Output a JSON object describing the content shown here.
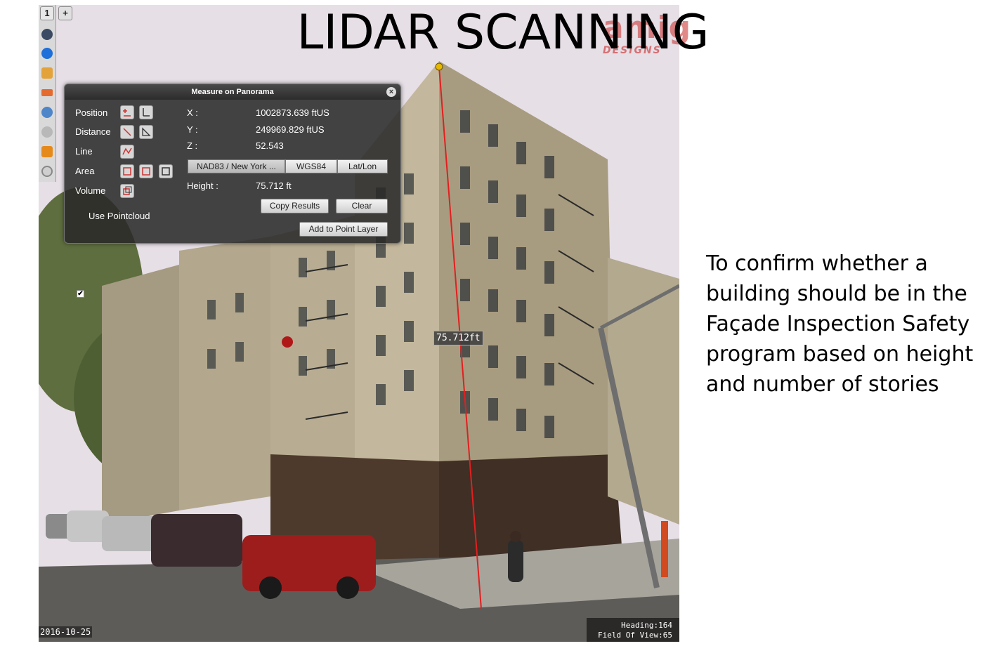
{
  "slide": {
    "title": "LIDAR SCANNING",
    "watermark": "amig",
    "watermark_sub": "DESIGNS",
    "description": "To confirm whether a building should be in the Façade Inspection Safety program based on height and number of stories"
  },
  "viewer": {
    "toolbar": {
      "zoom_level": "1",
      "zoom_in": "+",
      "tools": [
        "globe-icon",
        "info-icon",
        "layers-icon",
        "measure-icon",
        "map-icon",
        "sun-icon",
        "cluster-icon",
        "settings-icon"
      ]
    },
    "measure_panel": {
      "title": "Measure on Panorama",
      "close": "×",
      "tools": {
        "position": "Position",
        "distance": "Distance",
        "line": "Line",
        "area": "Area",
        "volume": "Volume"
      },
      "use_pointcloud": "Use Pointcloud",
      "use_pointcloud_checked": "✔",
      "coords": {
        "x_label": "X :",
        "x_value": "1002873.639 ftUS",
        "y_label": "Y :",
        "y_value": "249969.829 ftUS",
        "z_label": "Z :",
        "z_value": "52.543"
      },
      "crs_options": [
        "NAD83 / New York ...",
        "WGS84",
        "Lat/Lon"
      ],
      "height_label": "Height :",
      "height_value": "75.712 ft",
      "copy_results": "Copy Results",
      "clear": "Clear",
      "add_to_point_layer": "Add to Point Layer"
    },
    "measurement_label": "75.712ft",
    "date": "2016-10-25",
    "heading": "Heading:164",
    "field_of_view": "Field Of View:65",
    "colors": {
      "measure_line": "#e02020",
      "panel_bg": "#2a2a2a",
      "accent_icon": "#1e6fd9"
    }
  }
}
